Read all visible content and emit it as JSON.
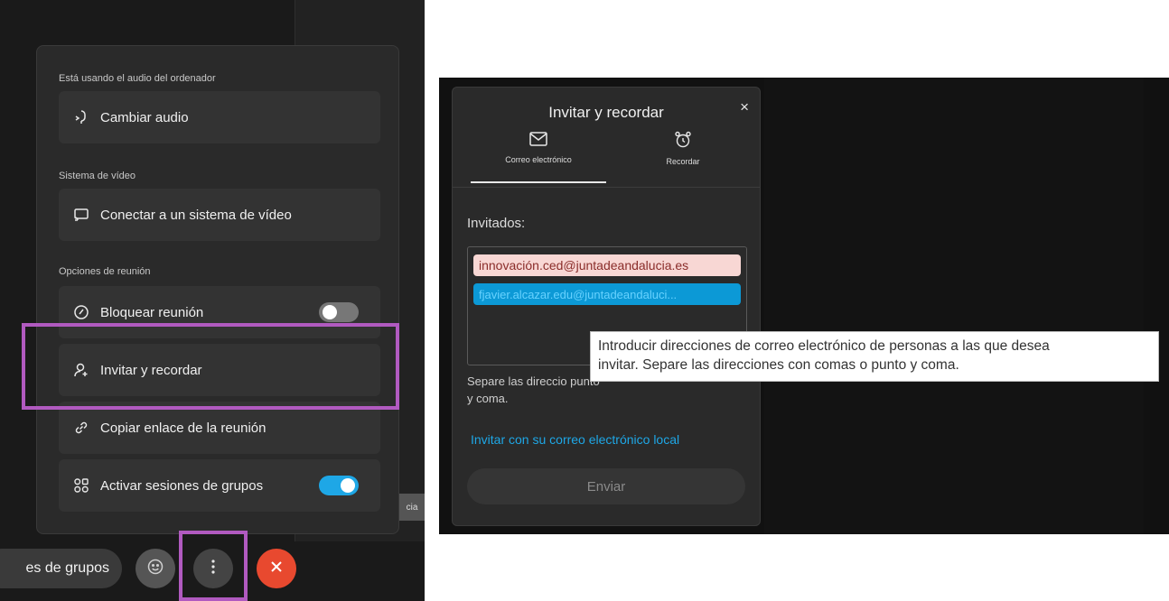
{
  "left_menu": {
    "audio_section_label": "Está usando el audio del ordenador",
    "change_audio_label": "Cambiar audio",
    "video_section_label": "Sistema de vídeo",
    "connect_video_label": "Conectar a un sistema de vídeo",
    "meeting_options_label": "Opciones de reunión",
    "lock_meeting_label": "Bloquear reunión",
    "lock_meeting_toggle": false,
    "invite_remind_label": "Invitar y recordar",
    "copy_link_label": "Copiar enlace de la reunión",
    "breakout_label": "Activar sesiones de grupos",
    "breakout_toggle": true
  },
  "bottom_bar": {
    "groups_pill_label": "es de grupos",
    "edge_chip_text": "cia"
  },
  "invite_dialog": {
    "title": "Invitar y recordar",
    "close_glyph": "×",
    "tabs": [
      {
        "label": "Correo electrónico",
        "icon": "envelope-icon",
        "selected": true
      },
      {
        "label": "Recordar",
        "icon": "alarm-clock-icon",
        "selected": false
      }
    ],
    "invitees_label": "Invitados:",
    "invitee_chips": [
      "innovación.ced@juntadeandalucia.es",
      "fjavier.alcazar.edu@juntadeandaluci..."
    ],
    "separator_hint": "Separe las direccio punto y coma.",
    "local_mail_link": "Invitar con su correo electrónico local",
    "send_label": "Enviar"
  },
  "tooltip": {
    "line1": "Introducir direcciones de correo electrónico de personas a las que desea",
    "line2": "invitar. Separe las direcciones con comas o punto y coma."
  },
  "colors": {
    "accent": "#1ea7e6",
    "highlight": "#b15ac0",
    "end_call": "#e8492f",
    "error_chip_bg": "#f8d7d4"
  }
}
